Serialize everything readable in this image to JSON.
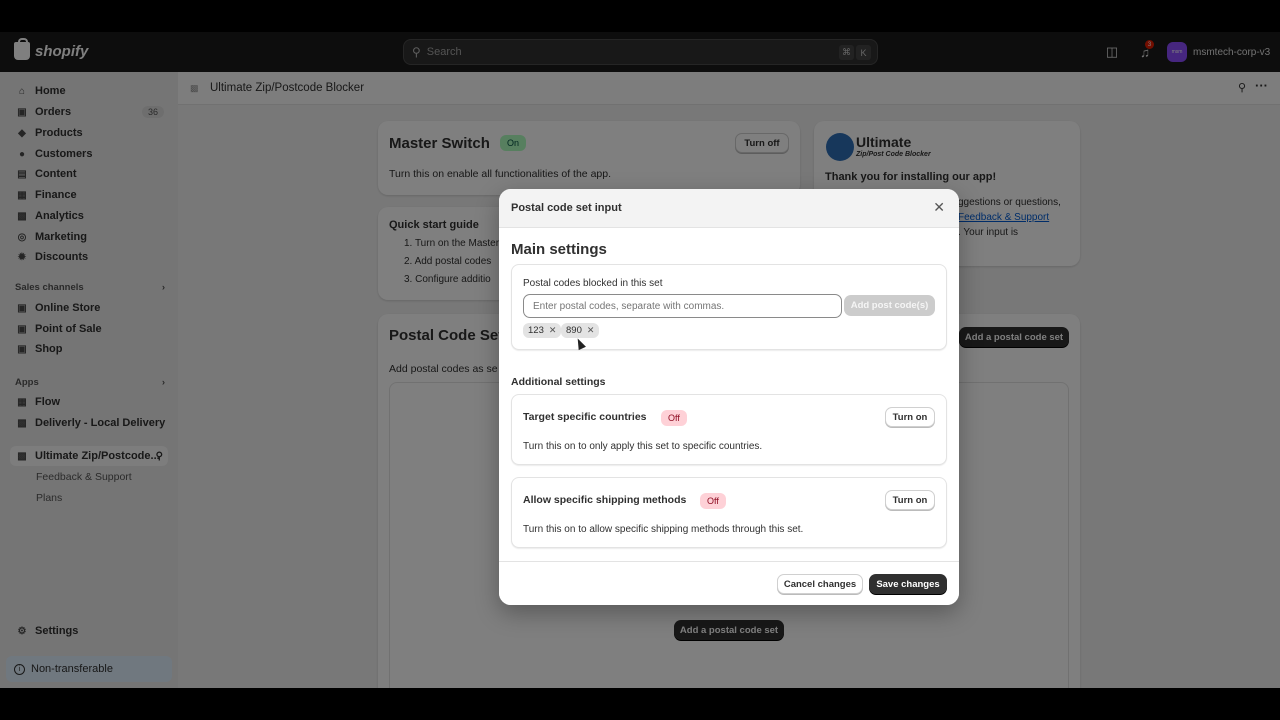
{
  "topbar": {
    "brand": "shopify",
    "search_placeholder": "Search",
    "shortcut_cmd": "⌘",
    "shortcut_key": "K",
    "notification_count": "3",
    "store_initials": "msm",
    "store_name": "msmtech-corp-v3"
  },
  "sidebar": {
    "items": [
      {
        "label": "Home",
        "icon": "home-icon"
      },
      {
        "label": "Orders",
        "icon": "orders-icon",
        "count": "36"
      },
      {
        "label": "Products",
        "icon": "tag-icon"
      },
      {
        "label": "Customers",
        "icon": "person-icon"
      },
      {
        "label": "Content",
        "icon": "content-icon"
      },
      {
        "label": "Finance",
        "icon": "bank-icon"
      },
      {
        "label": "Analytics",
        "icon": "chart-icon"
      },
      {
        "label": "Marketing",
        "icon": "target-icon"
      },
      {
        "label": "Discounts",
        "icon": "discount-icon"
      }
    ],
    "sales_channels_label": "Sales channels",
    "sales_channels": [
      {
        "label": "Online Store"
      },
      {
        "label": "Point of Sale"
      },
      {
        "label": "Shop"
      }
    ],
    "apps_label": "Apps",
    "apps": [
      {
        "label": "Flow"
      },
      {
        "label": "Deliverly - Local Delivery"
      },
      {
        "label": "Ultimate Zip/Postcode..."
      }
    ],
    "app_sub_items": [
      "Feedback & Support",
      "Plans"
    ],
    "settings_label": "Settings",
    "non_transferable_label": "Non-transferable"
  },
  "page": {
    "app_title": "Ultimate Zip/Postcode Blocker",
    "master_switch": {
      "title": "Master Switch",
      "badge": "On",
      "button": "Turn off",
      "desc": "Turn this on enable all functionalities of the app."
    },
    "quick_start": {
      "title": "Quick start guide",
      "steps": [
        "1. Turn on the Master",
        "2. Add postal codes",
        "3. Configure additio"
      ]
    },
    "promo": {
      "logo_title": "Ultimate",
      "logo_sub": "Zip/Post Code Blocker",
      "thanks": "Thank you for installing our app!",
      "line1": "ggestions or questions,",
      "link": "Feedback & Support",
      "line3": ". Your input is"
    },
    "postal_sets": {
      "title": "Postal Code Set",
      "add_button": "Add a postal code set",
      "desc": "Add postal codes as se",
      "add_button_bottom": "Add a postal code set"
    }
  },
  "modal": {
    "title": "Postal code set input",
    "main_heading": "Main settings",
    "codes_label": "Postal codes blocked in this set",
    "codes_placeholder": "Enter postal codes, separate with commas.",
    "add_button": "Add post code(s)",
    "tags": [
      "123",
      "890"
    ],
    "additional_heading": "Additional settings",
    "countries": {
      "title": "Target specific countries",
      "badge": "Off",
      "button": "Turn on",
      "desc": "Turn this on to only apply this set to specific countries."
    },
    "shipping": {
      "title": "Allow specific shipping methods",
      "badge": "Off",
      "button": "Turn on",
      "desc": "Turn this on to allow specific shipping methods through this set."
    },
    "cancel_button": "Cancel changes",
    "save_button": "Save changes"
  },
  "colors": {
    "topbar": "#1a1a1a",
    "primary_button": "#303030",
    "badge_on": "#affebf",
    "badge_off": "#fed1d7",
    "link": "#005bd3"
  }
}
